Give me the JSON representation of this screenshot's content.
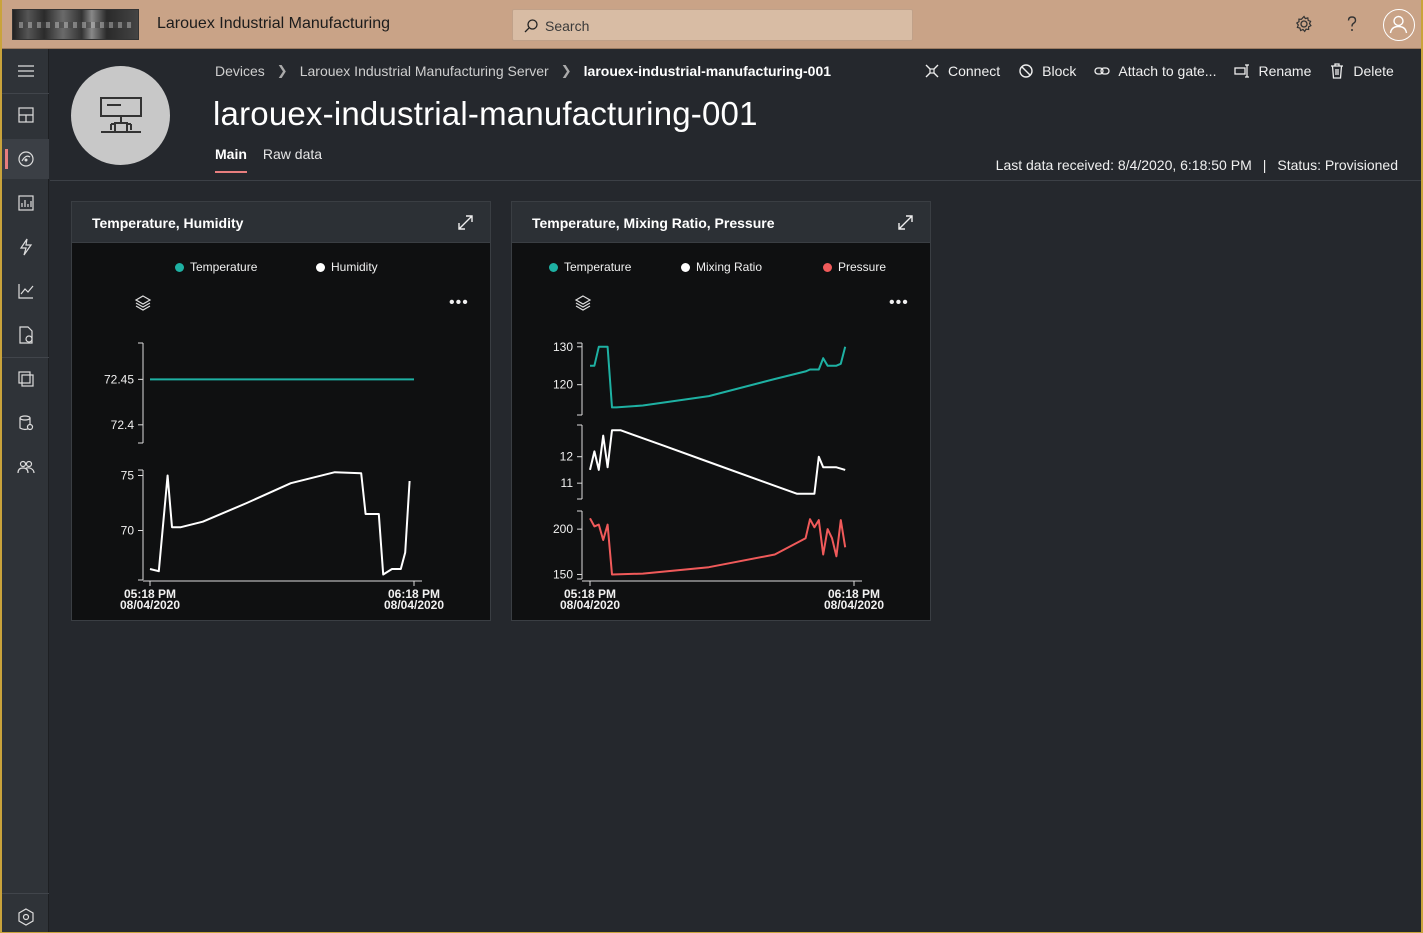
{
  "app": {
    "title": "Larouex Industrial Manufacturing",
    "search_placeholder": "Search"
  },
  "nav": {
    "items": [
      "menu-icon",
      "dashboard-icon",
      "devices-icon",
      "analytics-icon",
      "rules-icon",
      "chart-icon",
      "jobs-icon",
      "device-templates-icon",
      "data-export-icon",
      "administration-icon",
      "settings-icon"
    ],
    "active": "devices-icon"
  },
  "breadcrumb": [
    "Devices",
    "Larouex Industrial Manufacturing Server",
    "larouex-industrial-manufacturing-001"
  ],
  "commands": [
    "Connect",
    "Block",
    "Attach to gate...",
    "Rename",
    "Delete"
  ],
  "device": {
    "name": "larouex-industrial-manufacturing-001",
    "tabs": [
      "Main",
      "Raw data"
    ],
    "active_tab": "Main",
    "last_data": "Last data received: 8/4/2020, 6:18:50 PM",
    "status": "Status: Provisioned"
  },
  "colors": {
    "temperature": "#1eb1a3",
    "humidity": "#ffffff",
    "mixing_ratio": "#ffffff",
    "pressure": "#f05a5a",
    "accent": "#e87e7e",
    "topbar": "#c9a387"
  },
  "tiles": [
    {
      "title": "Temperature, Humidity",
      "legend": [
        "Temperature",
        "Humidity"
      ]
    },
    {
      "title": "Temperature, Mixing Ratio, Pressure",
      "legend": [
        "Temperature",
        "Mixing Ratio",
        "Pressure"
      ]
    }
  ],
  "chart_data": [
    {
      "type": "line",
      "title": "Temperature, Humidity",
      "x_ticks": [
        [
          "05:18 PM",
          "08/04/2020"
        ],
        [
          "06:18 PM",
          "08/04/2020"
        ]
      ],
      "x_range": [
        "2020-08-04 17:18",
        "2020-08-04 18:18"
      ],
      "panels": [
        {
          "series": [
            {
              "name": "Temperature",
              "color": "#1eb1a3",
              "x": [
                "17:18",
                "17:30",
                "17:45",
                "18:00",
                "18:18"
              ],
              "values": [
                72.45,
                72.45,
                72.45,
                72.45,
                72.45
              ]
            }
          ],
          "y_ticks": [
            72.45,
            72.4
          ],
          "ylim": [
            72.38,
            72.49
          ]
        },
        {
          "series": [
            {
              "name": "Humidity",
              "color": "#ffffff",
              "x": [
                "17:18",
                "17:20",
                "17:22",
                "17:23",
                "17:25",
                "17:30",
                "17:40",
                "17:50",
                "18:00",
                "18:06",
                "18:07",
                "18:10",
                "18:11",
                "18:13",
                "18:15",
                "18:16",
                "18:17"
              ],
              "values": [
                66.5,
                66.3,
                75.0,
                70.3,
                70.3,
                70.8,
                72.5,
                74.3,
                75.3,
                75.2,
                71.5,
                71.5,
                66.0,
                66.5,
                66.5,
                68.0,
                74.5
              ]
            }
          ],
          "y_ticks": [
            75,
            70
          ],
          "ylim": [
            65.5,
            75.5
          ]
        }
      ]
    },
    {
      "type": "line",
      "title": "Temperature, Mixing Ratio, Pressure",
      "x_ticks": [
        [
          "05:18 PM",
          "08/04/2020"
        ],
        [
          "06:18 PM",
          "08/04/2020"
        ]
      ],
      "x_range": [
        "2020-08-04 17:18",
        "2020-08-04 18:18"
      ],
      "panels": [
        {
          "series": [
            {
              "name": "Temperature",
              "color": "#1eb1a3",
              "x": [
                "17:18",
                "17:19",
                "17:20",
                "17:22",
                "17:23",
                "17:24",
                "17:30",
                "17:45",
                "18:00",
                "18:07",
                "18:08",
                "18:10",
                "18:11",
                "18:12",
                "18:14",
                "18:15",
                "18:16"
              ],
              "values": [
                125,
                125,
                130,
                130,
                114,
                114,
                114.5,
                117,
                121.5,
                123.5,
                124,
                124,
                127,
                125,
                125,
                125.5,
                130
              ]
            }
          ],
          "y_ticks": [
            130,
            120
          ],
          "ylim": [
            112,
            131
          ]
        },
        {
          "series": [
            {
              "name": "Mixing Ratio",
              "color": "#ffffff",
              "x": [
                "17:18",
                "17:19",
                "17:20",
                "17:21",
                "17:22",
                "17:23",
                "17:25",
                "17:35",
                "17:45",
                "18:00",
                "18:05",
                "18:09",
                "18:10",
                "18:11",
                "18:14",
                "18:16"
              ],
              "values": [
                11.5,
                12.2,
                11.5,
                12.8,
                11.6,
                13.0,
                13.0,
                12.4,
                11.8,
                10.9,
                10.6,
                10.6,
                12.0,
                11.6,
                11.6,
                11.5
              ]
            }
          ],
          "y_ticks": [
            12,
            11
          ],
          "ylim": [
            10.4,
            13.2
          ]
        },
        {
          "series": [
            {
              "name": "Pressure",
              "color": "#f05a5a",
              "x": [
                "17:18",
                "17:19",
                "17:20",
                "17:21",
                "17:22",
                "17:23",
                "17:30",
                "17:45",
                "18:00",
                "18:07",
                "18:08",
                "18:09",
                "18:10",
                "18:11",
                "18:12",
                "18:13",
                "18:14",
                "18:15",
                "18:16"
              ],
              "values": [
                212,
                203,
                205,
                188,
                205,
                150,
                151,
                158,
                172,
                190,
                211,
                202,
                210,
                172,
                200,
                190,
                170,
                210,
                180
              ]
            }
          ],
          "y_ticks": [
            200,
            150
          ],
          "ylim": [
            145,
            220
          ]
        }
      ]
    }
  ]
}
